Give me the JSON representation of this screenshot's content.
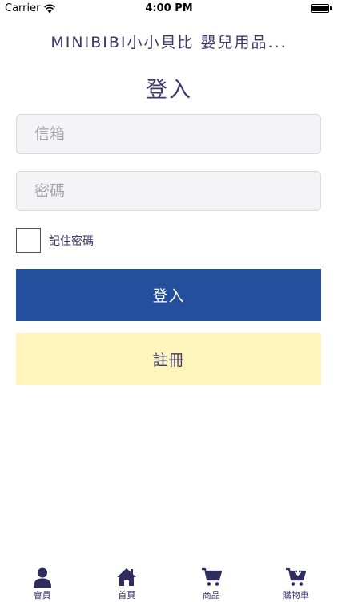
{
  "status_bar": {
    "carrier": "Carrier",
    "time": "4:00 PM"
  },
  "nav": {
    "title": "MINIBIBI小小貝比 嬰兒用品..."
  },
  "page": {
    "title": "登入"
  },
  "form": {
    "email_placeholder": "信箱",
    "email_value": "",
    "password_placeholder": "密碼",
    "password_value": "",
    "remember_label": "記住密碼",
    "remember_checked": false,
    "login_label": "登入",
    "register_label": "註冊"
  },
  "tab_bar": {
    "items": [
      {
        "label": "會員",
        "icon": "member-icon"
      },
      {
        "label": "首頁",
        "icon": "home-icon"
      },
      {
        "label": "商品",
        "icon": "cart-icon"
      },
      {
        "label": "購物車",
        "icon": "cart-download-icon"
      }
    ]
  },
  "colors": {
    "primary": "#234f9c",
    "accent_text": "#3d3a6b",
    "register_bg": "#fdf5bb",
    "input_bg": "#f4f4f6"
  }
}
